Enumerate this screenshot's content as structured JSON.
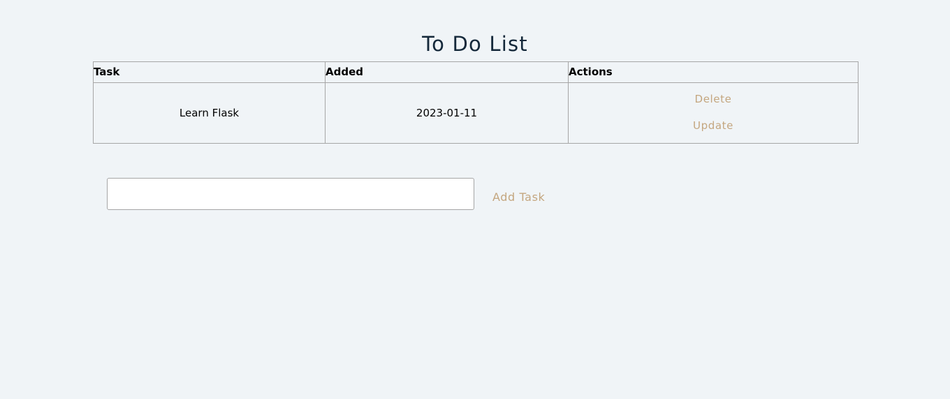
{
  "header": {
    "title": "To Do List"
  },
  "table": {
    "columns": [
      "Task",
      "Added",
      "Actions"
    ],
    "rows": [
      {
        "task": "Learn Flask",
        "added": "2023-01-11",
        "delete_label": "Delete",
        "update_label": "Update"
      }
    ]
  },
  "form": {
    "input_value": "",
    "input_placeholder": "",
    "add_label": "Add Task"
  },
  "colors": {
    "background": "#f0f4f7",
    "title": "#14283a",
    "link": "#c4a67f",
    "border": "#a6a6a6"
  }
}
